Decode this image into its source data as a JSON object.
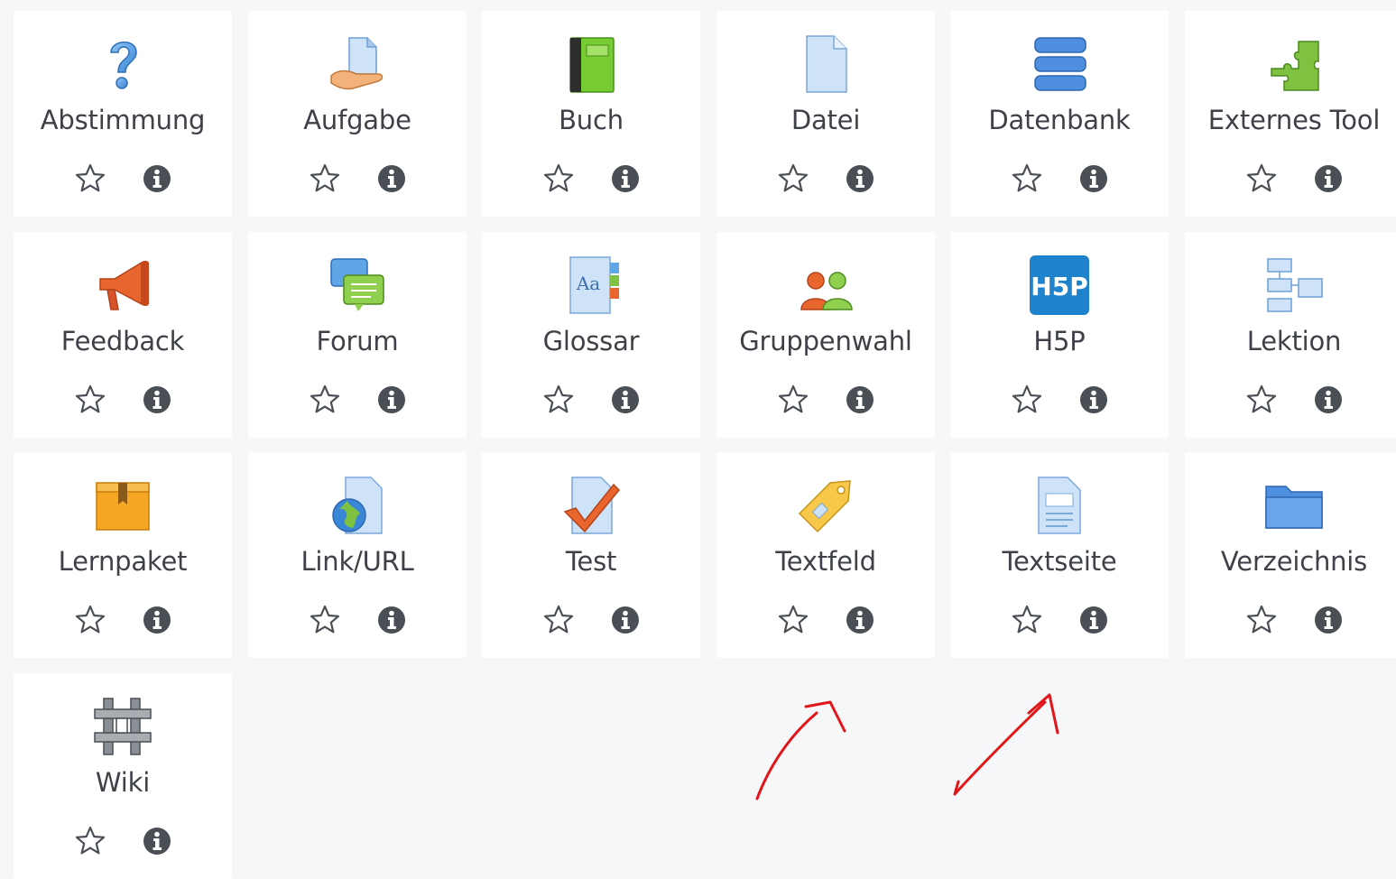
{
  "activities": [
    {
      "label": "Abstimmung",
      "icon": "question-icon"
    },
    {
      "label": "Aufgabe",
      "icon": "assignment-hand-icon"
    },
    {
      "label": "Buch",
      "icon": "book-icon"
    },
    {
      "label": "Datei",
      "icon": "file-icon"
    },
    {
      "label": "Datenbank",
      "icon": "database-icon"
    },
    {
      "label": "Externes Tool",
      "icon": "puzzle-icon"
    },
    {
      "label": "Feedback",
      "icon": "megaphone-icon"
    },
    {
      "label": "Forum",
      "icon": "forum-bubbles-icon"
    },
    {
      "label": "Glossar",
      "icon": "glossary-icon"
    },
    {
      "label": "Gruppenwahl",
      "icon": "group-choice-icon"
    },
    {
      "label": "H5P",
      "icon": "h5p-icon"
    },
    {
      "label": "Lektion",
      "icon": "lesson-flow-icon"
    },
    {
      "label": "Lernpaket",
      "icon": "package-icon"
    },
    {
      "label": "Link/URL",
      "icon": "url-globe-icon"
    },
    {
      "label": "Test",
      "icon": "quiz-check-icon"
    },
    {
      "label": "Textfeld",
      "icon": "label-tag-icon"
    },
    {
      "label": "Textseite",
      "icon": "page-icon"
    },
    {
      "label": "Verzeichnis",
      "icon": "folder-icon"
    },
    {
      "label": "Wiki",
      "icon": "wiki-icon"
    }
  ],
  "h5p_logo_text": "H5P",
  "glossary_icon_text": "Aa",
  "colors": {
    "page_bg": "#f6f7f9",
    "tile_bg": "#ffffff",
    "label_text": "#3e4248",
    "action_icon": "#4a4f55",
    "annotation_red": "#e0161a"
  }
}
